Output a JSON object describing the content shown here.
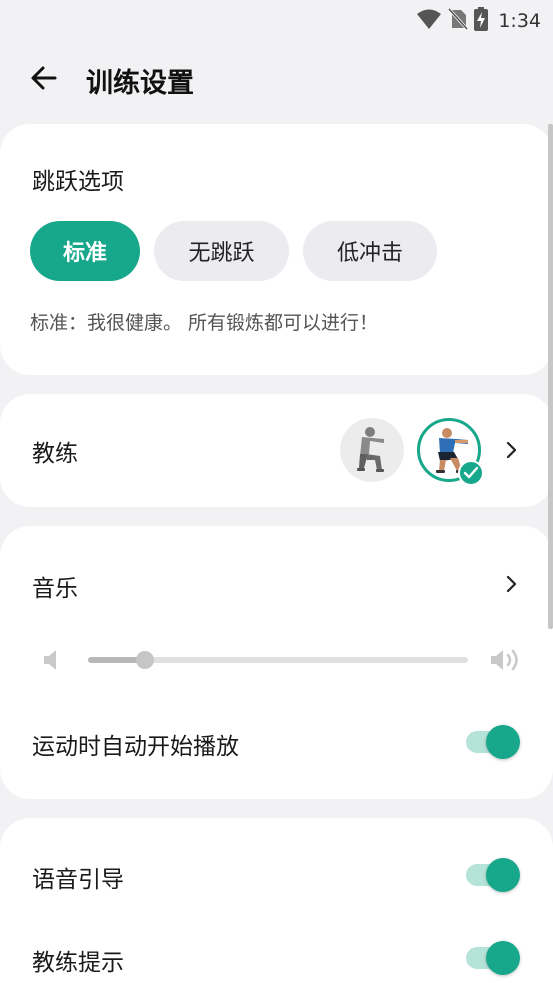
{
  "status_bar": {
    "time": "1:34",
    "icons": [
      "wifi-icon",
      "no-sim-icon",
      "battery-charging-icon"
    ]
  },
  "header": {
    "title": "训练设置",
    "back_icon": "arrow-left-icon"
  },
  "jump_options": {
    "title": "跳跃选项",
    "chips": [
      {
        "label": "标准",
        "selected": true
      },
      {
        "label": "无跳跃",
        "selected": false
      },
      {
        "label": "低冲击",
        "selected": false
      }
    ],
    "description": "标准：我很健康。 所有锻炼都可以进行！"
  },
  "coach": {
    "label": "教练",
    "selected_index": 1,
    "accent": "#17a88c"
  },
  "music": {
    "label": "音乐",
    "volume_fraction": 0.15,
    "autoplay_label": "运动时自动开始播放",
    "autoplay_on": true
  },
  "voice": {
    "voice_guide_label": "语音引导",
    "voice_guide_on": true,
    "coach_tips_label": "教练提示",
    "coach_tips_on": true
  },
  "colors": {
    "accent": "#17a88c",
    "toggle_track": "#b6e3d8",
    "background": "#f2f2f4"
  }
}
